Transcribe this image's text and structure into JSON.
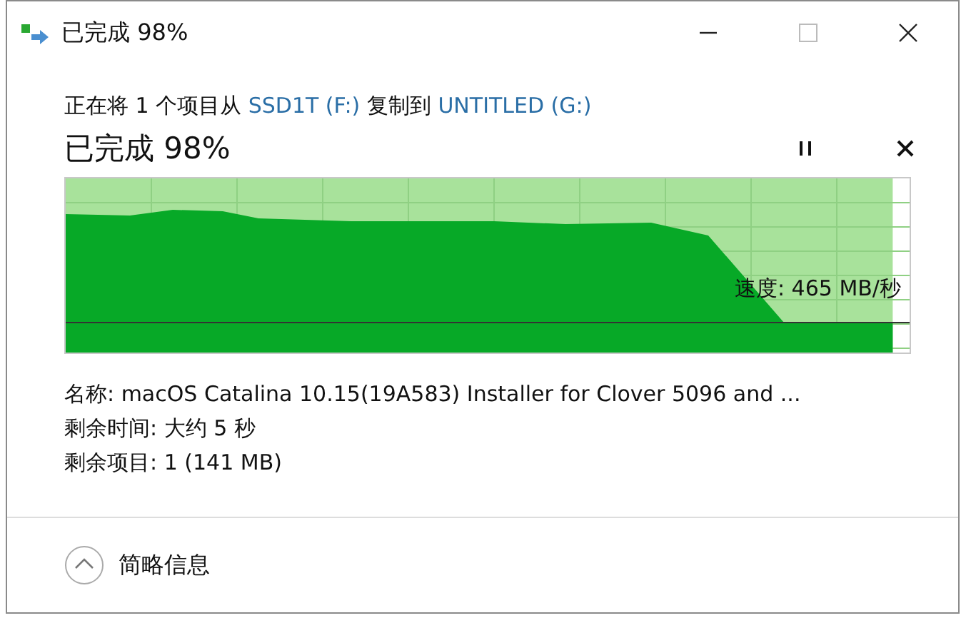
{
  "window": {
    "title": "已完成 98%"
  },
  "description": {
    "prefix": "正在将 1 个项目从",
    "source": "SSD1T (F:)",
    "middle": "复制到",
    "destination": "UNTITLED (G:)"
  },
  "progress": {
    "heading": "已完成 98%",
    "level": 0.98,
    "speed": "速度: 465 MB/秒"
  },
  "details": [
    "名称: macOS Catalina 10.15(19A583) Installer for Clover 5096 and ...",
    "剩余时间: 大约 5 秒",
    "剩余项目: 1 (141 MB)"
  ],
  "footer": {
    "toggle": "简略信息",
    "expanded": true
  }
}
